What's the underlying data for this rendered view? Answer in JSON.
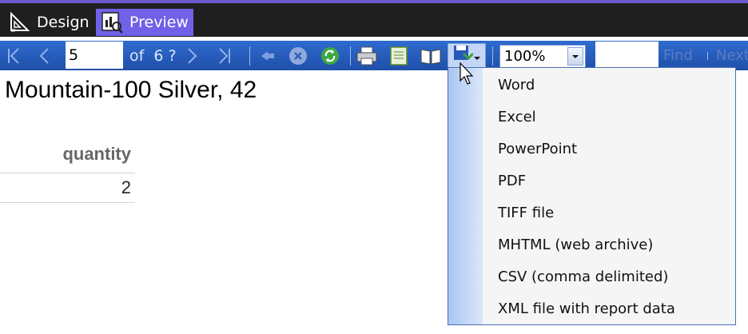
{
  "tabs": [
    {
      "label": "Design",
      "icon": "ruler-triangle-icon"
    },
    {
      "label": "Preview",
      "icon": "report-preview-icon",
      "active": true
    }
  ],
  "toolbar": {
    "page_value": "5",
    "of_label": "of",
    "total_pages": "6 ?",
    "zoom_value": "100%",
    "find_label": "Find",
    "next_label": "Next",
    "icons": [
      "first-page-icon",
      "previous-page-icon",
      "next-page-icon",
      "last-page-icon",
      "back-icon",
      "stop-icon",
      "refresh-icon",
      "print-icon",
      "print-layout-icon",
      "page-setup-icon",
      "export-icon"
    ]
  },
  "report": {
    "title": "Mountain-100 Silver, 42",
    "column_header": "quantity",
    "rows": [
      {
        "quantity": "2"
      }
    ]
  },
  "export_menu": {
    "items": [
      "Word",
      "Excel",
      "PowerPoint",
      "PDF",
      "TIFF file",
      "MHTML (web archive)",
      "CSV (comma delimited)",
      "XML file with report data"
    ]
  },
  "colors": {
    "toolbar_blue": "#2f6bd0",
    "active_tab": "#7160e8",
    "tab_bar": "#1f1f1f"
  }
}
